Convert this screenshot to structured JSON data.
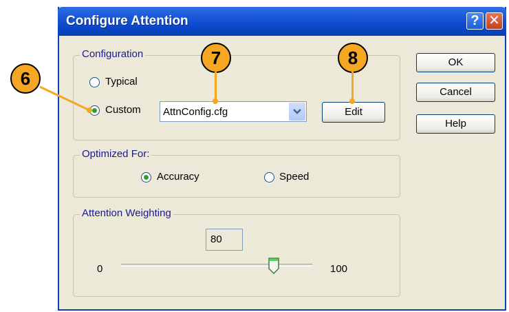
{
  "window": {
    "title": "Configure Attention"
  },
  "titlebar_buttons": {
    "help": "?",
    "close": "✕"
  },
  "configuration": {
    "label": "Configuration",
    "typical_label": "Typical",
    "custom_label": "Custom",
    "selected": "Custom",
    "file_value": "AttnConfig.cfg",
    "edit_label": "Edit"
  },
  "optimized_for": {
    "label": "Optimized For:",
    "accuracy_label": "Accuracy",
    "speed_label": "Speed",
    "selected": "Accuracy"
  },
  "attention_weighting": {
    "label": "Attention Weighting",
    "value": "80",
    "min_label": "0",
    "max_label": "100",
    "slider_fraction": 0.8
  },
  "buttons": {
    "ok": "OK",
    "cancel": "Cancel",
    "help": "Help"
  },
  "callouts": {
    "six": "6",
    "seven": "7",
    "eight": "8"
  },
  "colors": {
    "callout": "#f5a623",
    "titlebar": "#0a47c9",
    "radio_dot": "#2aa12a"
  }
}
